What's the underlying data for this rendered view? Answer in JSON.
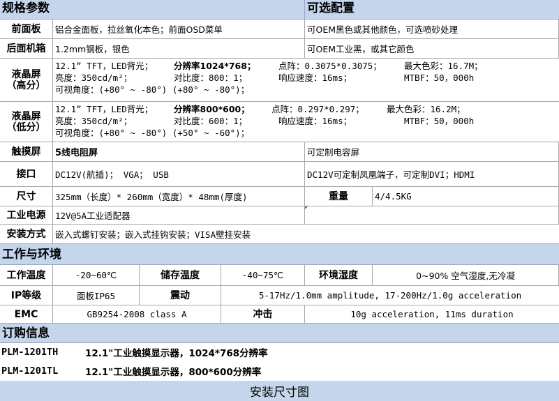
{
  "spec_section": {
    "title": "规格参数",
    "options_title": "可选配置"
  },
  "rows": {
    "front_panel": {
      "label": "前面板",
      "value": "铝合金面板，拉丝氧化本色；前面OSD菜单",
      "option": "可OEM黑色或其他颜色，可选喷砂处理"
    },
    "rear_case": {
      "label": "后面机箱",
      "value": "1.2mm钢板，银色",
      "option": "可OEM工业黑，或其它颜色"
    },
    "lcd_high": {
      "label_line1": "液晶屏",
      "label_line2": "（高分）",
      "line1_a": "12.1” TFT，LED背光；",
      "line1_b": "分辨率1024*768；",
      "line1_c": "点阵：0.3075*0.3075；",
      "line1_d": "最大色彩：16.7M；",
      "line2_a": "亮度：350cd/m²；",
      "line2_b": "对比度：800：1；",
      "line2_c": "响应速度：16ms；",
      "line2_d": "MTBF：50，000h",
      "line3": "可视角度：(+80° ~ -80°) (+80° ~ -80°)；"
    },
    "lcd_low": {
      "label_line1": "液晶屏",
      "label_line2": "（低分）",
      "line1_a": "12.1” TFT，LED背光；",
      "line1_b": "分辨率800*600；",
      "line1_c": "点阵：0.297*0.297；",
      "line1_d": "最大色彩：16.2M；",
      "line2_a": "亮度：350cd/m²；",
      "line2_b": "对比度：600：1；",
      "line2_c": "响应速度：16ms；",
      "line2_d": "MTBF：50，000h",
      "line3": "可视角度：(+80° ~ -80°) (+50° ~ -60°)；"
    },
    "touch": {
      "label": "触摸屏",
      "value": "5线电阻屏",
      "option": "可定制电容屏"
    },
    "interface": {
      "label": "接口",
      "value": "DC12V(航插)； VGA； USB",
      "option": "DC12V可定制凤凰端子，可定制DVI；HDMI"
    },
    "size": {
      "label": "尺寸",
      "value": "325mm（长度）* 260mm（宽度）* 48mm(厚度)",
      "weight_label": "重量",
      "weight_value": "4/4.5KG"
    },
    "power": {
      "label": "工业电源",
      "value": "12V@5A工业适配器"
    },
    "mount": {
      "label": "安装方式",
      "value": "嵌入式螺钉安装；嵌入式挂钩安装；VISA壁挂安装"
    }
  },
  "env_section": {
    "title": "工作与环境"
  },
  "env": {
    "work_temp_label": "工作温度",
    "work_temp": "-20~60℃",
    "store_temp_label": "储存温度",
    "store_temp": "-40~75℃",
    "humidity_label": "环境湿度",
    "humidity": "0~90% 空气湿度,无冷凝",
    "ip_label": "IP等级",
    "ip": "面板IP65",
    "vibration_label": "震动",
    "vibration": "5-17Hz/1.0mm amplitude, 17-200Hz/1.0g acceleration",
    "emc_label": "EMC",
    "emc": "GB9254-2008 class A",
    "shock_label": "冲击",
    "shock": "10g acceleration, 11ms duration"
  },
  "order_section": {
    "title": "订购信息"
  },
  "order": [
    {
      "code": "PLM-1201TH",
      "desc": "12.1\"工业触摸显示器，1024*768分辨率"
    },
    {
      "code": "PLM-1201TL",
      "desc": "12.1\"工业触摸显示器，800*600分辨率"
    }
  ],
  "install_section": {
    "title": "安装尺寸图"
  }
}
